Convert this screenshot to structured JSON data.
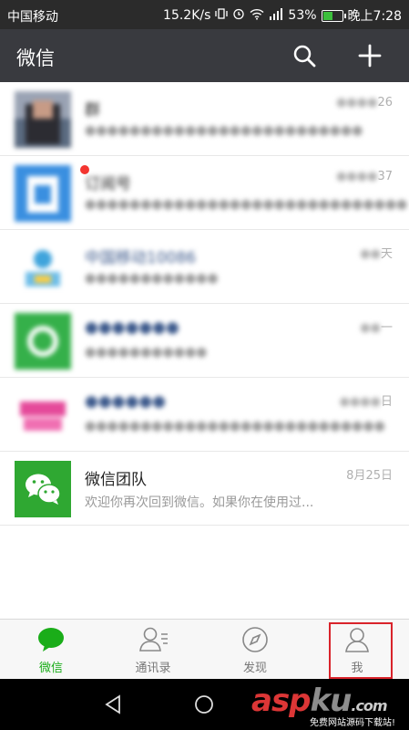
{
  "status_bar": {
    "carrier": "中国移动",
    "network_speed": "15.2K/s",
    "battery": "53%",
    "battery_level": 0.53,
    "time": "晚上7:28"
  },
  "app_bar": {
    "title": "微信"
  },
  "chats": [
    {
      "title": "群",
      "subtitle": "",
      "time": "26",
      "blurred": true
    },
    {
      "title": "订阅号",
      "subtitle": "",
      "time": "37",
      "blurred": true,
      "unread_dot": true
    },
    {
      "title": "中国移动10086",
      "subtitle": "",
      "time": "天",
      "blurred": true
    },
    {
      "title": "",
      "subtitle": "",
      "time": "一",
      "blurred": true
    },
    {
      "title": "",
      "subtitle": "",
      "time": "日",
      "blurred": true
    },
    {
      "title": "微信团队",
      "subtitle": "欢迎你再次回到微信。如果你在使用过...",
      "time": "8月25日",
      "blurred": false
    }
  ],
  "tabs": [
    {
      "label": "微信",
      "active": true
    },
    {
      "label": "通讯录",
      "active": false
    },
    {
      "label": "发现",
      "active": false
    },
    {
      "label": "我",
      "active": false
    }
  ],
  "watermark": {
    "text_a": "asp",
    "text_b": "ku",
    "suffix": ".com",
    "subtitle": "免费网站源码下载站!"
  },
  "colors": {
    "accent": "#1aad19",
    "appbar": "#393a3f",
    "highlight": "#d9232b"
  }
}
